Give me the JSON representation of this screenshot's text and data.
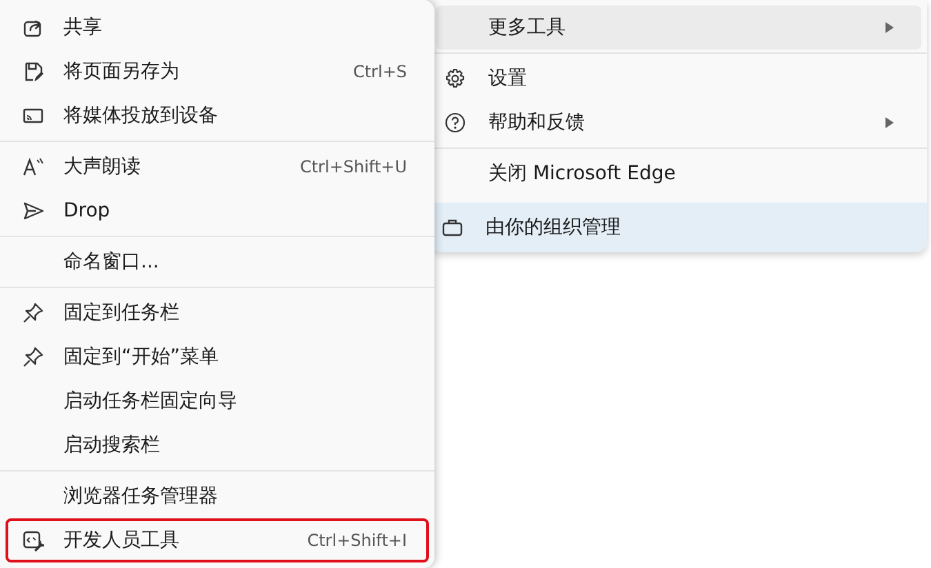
{
  "main_menu": {
    "items": [
      {
        "kind": "item",
        "label": "更多工具",
        "selected": true,
        "submenu": true
      },
      {
        "kind": "divider"
      },
      {
        "kind": "item",
        "label": "设置",
        "selected": false,
        "submenu": false
      },
      {
        "kind": "item",
        "label": "帮助和反馈",
        "selected": false,
        "submenu": true
      },
      {
        "kind": "divider"
      },
      {
        "kind": "item",
        "label": "关闭 Microsoft Edge",
        "selected": false,
        "submenu": false
      },
      {
        "kind": "banner",
        "label": "由你的组织管理"
      }
    ]
  },
  "submenu": {
    "items": [
      {
        "kind": "item",
        "label": "共享",
        "outlined": false
      },
      {
        "kind": "item",
        "label": "将页面另存为",
        "shortcut": "Ctrl+S",
        "outlined": false
      },
      {
        "kind": "item",
        "label": "将媒体投放到设备",
        "outlined": false
      },
      {
        "kind": "divider"
      },
      {
        "kind": "item",
        "label": "大声朗读",
        "shortcut": "Ctrl+Shift+U",
        "outlined": false
      },
      {
        "kind": "item",
        "label": "Drop",
        "outlined": false
      },
      {
        "kind": "divider"
      },
      {
        "kind": "item",
        "label": "命名窗口...",
        "outlined": false
      },
      {
        "kind": "divider"
      },
      {
        "kind": "item",
        "label": "固定到任务栏",
        "outlined": false
      },
      {
        "kind": "item",
        "label": "固定到“开始”菜单",
        "outlined": false
      },
      {
        "kind": "item",
        "label": "启动任务栏固定向导",
        "outlined": false
      },
      {
        "kind": "item",
        "label": "启动搜索栏",
        "outlined": false
      },
      {
        "kind": "divider"
      },
      {
        "kind": "item",
        "label": "浏览器任务管理器",
        "outlined": false
      },
      {
        "kind": "item",
        "label": "开发人员工具",
        "shortcut": "Ctrl+Shift+I",
        "outlined": true
      }
    ]
  }
}
